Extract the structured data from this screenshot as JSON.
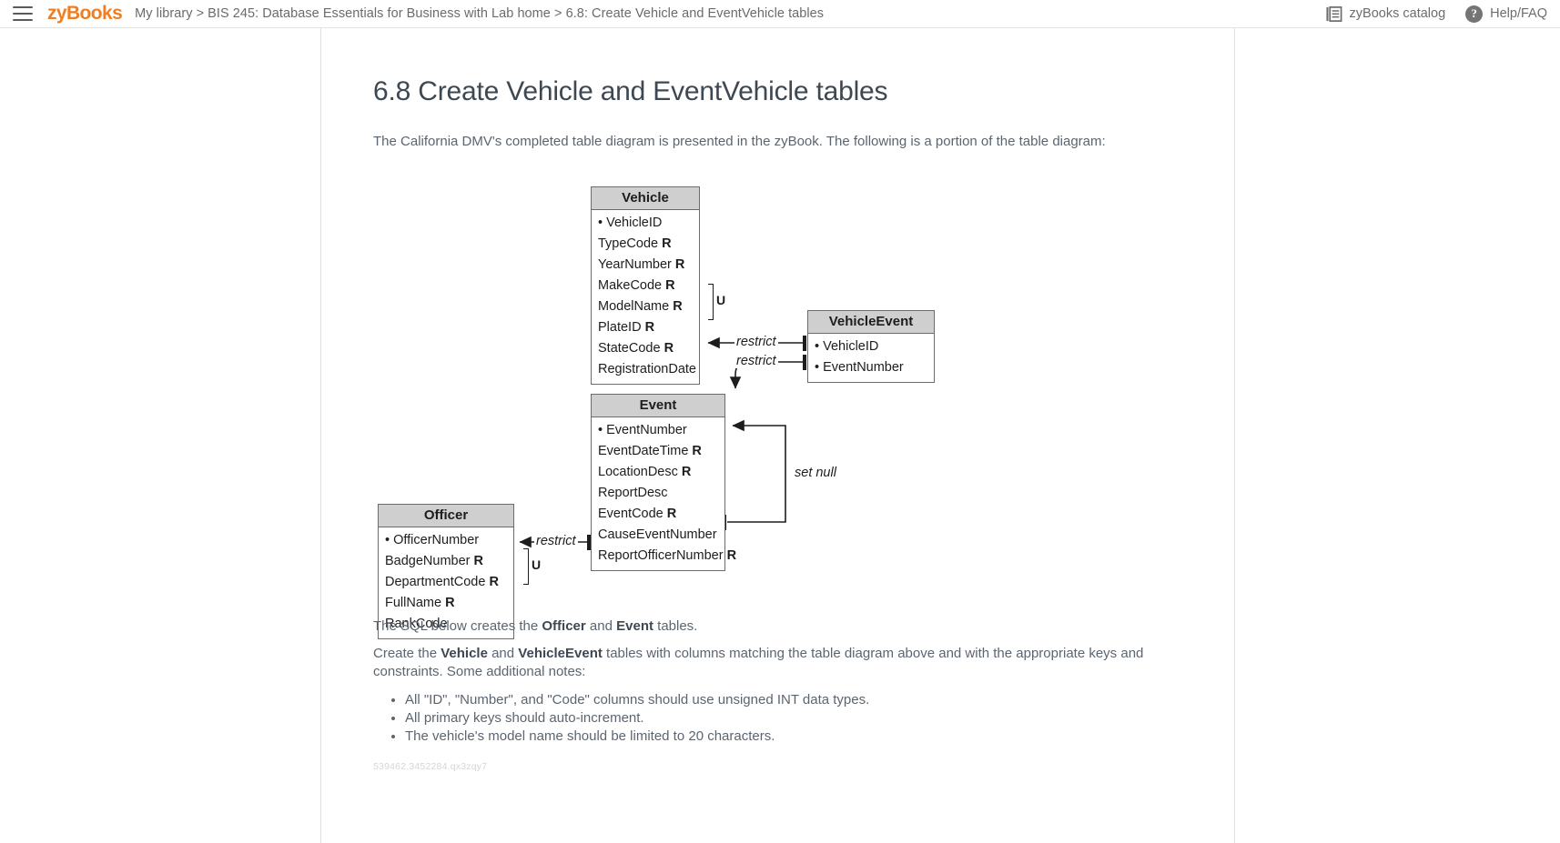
{
  "header": {
    "menu_icon": "hamburger-menu-icon",
    "brand": "zyBooks",
    "breadcrumb": "My library > BIS 245: Database Essentials for Business with Lab home > 6.8: Create Vehicle and EventVehicle tables",
    "catalog_label": "zyBooks catalog",
    "catalog_icon": "book-catalog-icon",
    "help_label": "Help/FAQ",
    "help_icon": "question-mark-icon",
    "brand_color": "#f07e20"
  },
  "main": {
    "title": "6.8 Create Vehicle and EventVehicle tables",
    "intro": "The California DMV's completed table diagram is presented in the zyBook. The following is a portion of the table diagram:",
    "sql_para_prefix": "The SQL below creates the ",
    "sql_para_bold1": "Officer",
    "sql_para_mid": " and ",
    "sql_para_bold2": "Event",
    "sql_para_suffix": " tables.",
    "create_para_prefix": "Create the ",
    "create_para_bold1": "Vehicle",
    "create_para_mid": " and ",
    "create_para_bold2": "VehicleEvent",
    "create_para_suffix": " tables with columns matching the table diagram above and with the appropriate keys and constraints. Some additional notes:",
    "notes": [
      "All \"ID\", \"Number\", and \"Code\" columns should use unsigned INT data types.",
      "All primary keys should auto-increment.",
      "The vehicle's model name should be limited to 20 characters."
    ],
    "footer_code": "539462.3452284.qx3zqy7"
  },
  "diagram": {
    "tables": [
      {
        "name": "Vehicle",
        "fields": [
          {
            "label": "VehicleID",
            "pk": true,
            "req": false
          },
          {
            "label": "TypeCode",
            "pk": false,
            "req": true
          },
          {
            "label": "YearNumber",
            "pk": false,
            "req": true
          },
          {
            "label": "MakeCode",
            "pk": false,
            "req": true
          },
          {
            "label": "ModelName",
            "pk": false,
            "req": true
          },
          {
            "label": "PlateID",
            "pk": false,
            "req": true
          },
          {
            "label": "StateCode",
            "pk": false,
            "req": true
          },
          {
            "label": "RegistrationDate",
            "pk": false,
            "req": false
          }
        ],
        "unique_marker": "U"
      },
      {
        "name": "VehicleEvent",
        "fields": [
          {
            "label": "VehicleID",
            "pk": true,
            "req": false
          },
          {
            "label": "EventNumber",
            "pk": true,
            "req": false
          }
        ]
      },
      {
        "name": "Event",
        "fields": [
          {
            "label": "EventNumber",
            "pk": true,
            "req": false
          },
          {
            "label": "EventDateTime",
            "pk": false,
            "req": true
          },
          {
            "label": "LocationDesc",
            "pk": false,
            "req": true
          },
          {
            "label": "ReportDesc",
            "pk": false,
            "req": false
          },
          {
            "label": "EventCode",
            "pk": false,
            "req": true
          },
          {
            "label": "CauseEventNumber",
            "pk": false,
            "req": false
          },
          {
            "label": "ReportOfficerNumber",
            "pk": false,
            "req": true
          }
        ]
      },
      {
        "name": "Officer",
        "fields": [
          {
            "label": "OfficerNumber",
            "pk": true,
            "req": false
          },
          {
            "label": "BadgeNumber",
            "pk": false,
            "req": true
          },
          {
            "label": "DepartmentCode",
            "pk": false,
            "req": true
          },
          {
            "label": "FullName",
            "pk": false,
            "req": true
          },
          {
            "label": "RankCode",
            "pk": false,
            "req": false
          }
        ],
        "unique_marker": "U"
      }
    ],
    "relationship_labels": {
      "restrict_vehicle": "restrict",
      "restrict_event": "restrict",
      "restrict_officer": "restrict",
      "set_null": "set null"
    },
    "required_marker": "R"
  }
}
